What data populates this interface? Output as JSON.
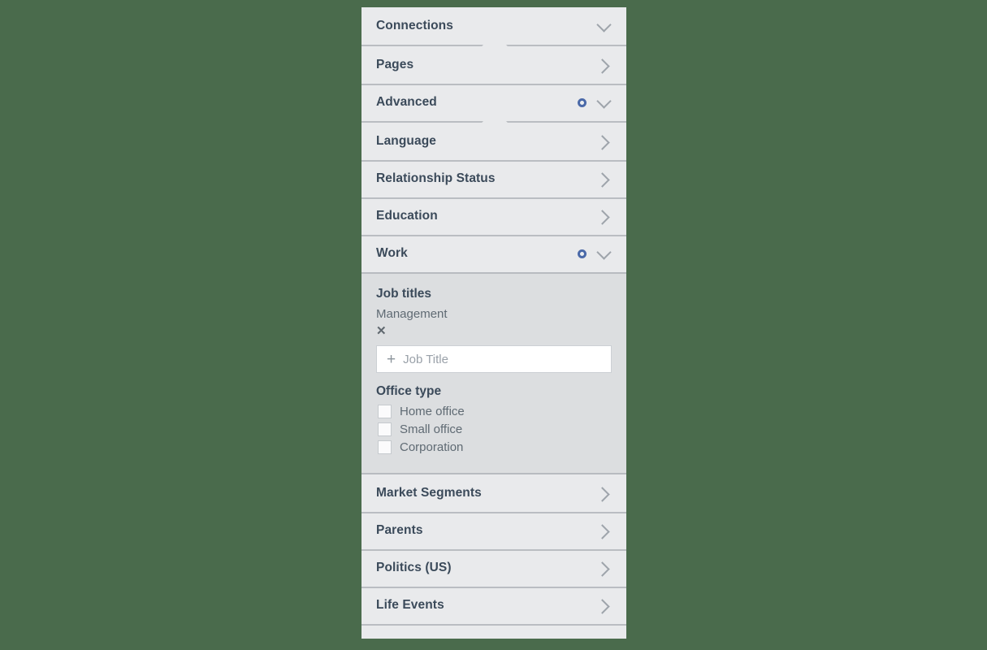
{
  "panel": {
    "background_color": "#e9eaec",
    "expanded_background_color": "#dcdee0",
    "accent_color": "#4a69a8",
    "title_color": "#3b4a5a",
    "page_background_color": "#4a6b4c"
  },
  "sections": [
    {
      "label": "Connections",
      "state": "expanded",
      "chevron": "chevron-down-icon",
      "has_dot": false,
      "notch_below": true
    },
    {
      "label": "Pages",
      "state": "collapsed",
      "chevron": "chevron-right-icon",
      "has_dot": false,
      "notch_below": false
    },
    {
      "label": "Advanced",
      "state": "expanded",
      "chevron": "chevron-down-icon",
      "has_dot": true,
      "notch_below": true
    },
    {
      "label": "Language",
      "state": "collapsed",
      "chevron": "chevron-right-icon",
      "has_dot": false,
      "notch_below": false
    },
    {
      "label": "Relationship Status",
      "state": "collapsed",
      "chevron": "chevron-right-icon",
      "has_dot": false,
      "notch_below": false
    },
    {
      "label": "Education",
      "state": "collapsed",
      "chevron": "chevron-right-icon",
      "has_dot": false,
      "notch_below": false
    },
    {
      "label": "Work",
      "state": "expanded",
      "chevron": "chevron-down-icon",
      "has_dot": true,
      "notch_below": false
    }
  ],
  "work_section": {
    "job_titles": {
      "label": "Job titles",
      "selected": [
        {
          "value": "Management",
          "remove_icon": "close-icon",
          "remove_glyph": "✕"
        }
      ],
      "input": {
        "plus_glyph": "+",
        "placeholder": "Job Title",
        "value": ""
      }
    },
    "office_type": {
      "label": "Office type",
      "options": [
        {
          "label": "Home office",
          "checked": false
        },
        {
          "label": "Small office",
          "checked": false
        },
        {
          "label": "Corporation",
          "checked": false
        }
      ]
    }
  },
  "sections_after": [
    {
      "label": "Market Segments",
      "state": "collapsed",
      "chevron": "chevron-right-icon"
    },
    {
      "label": "Parents",
      "state": "collapsed",
      "chevron": "chevron-right-icon"
    },
    {
      "label": "Politics (US)",
      "state": "collapsed",
      "chevron": "chevron-right-icon"
    },
    {
      "label": "Life Events",
      "state": "collapsed",
      "chevron": "chevron-right-icon"
    }
  ]
}
